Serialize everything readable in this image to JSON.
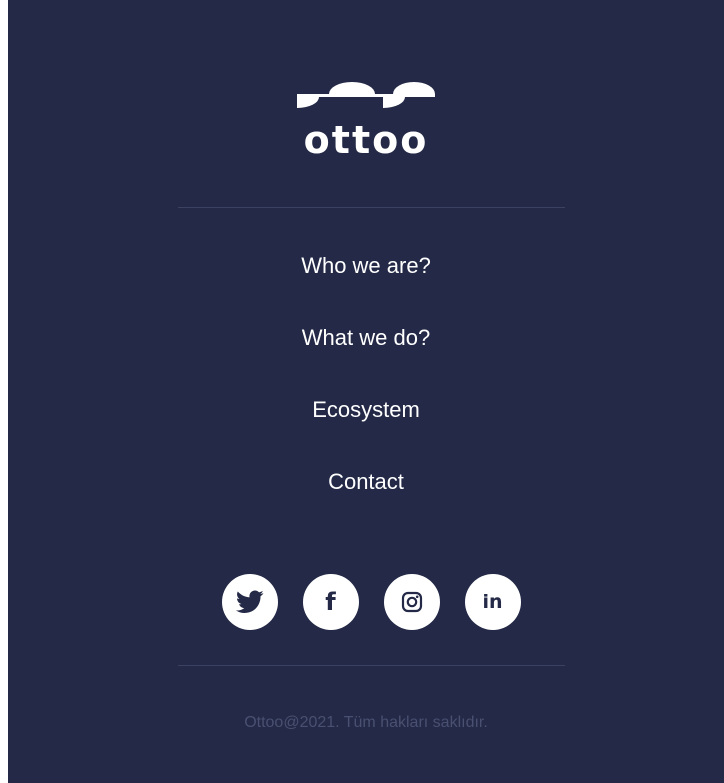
{
  "brand": {
    "name": "ottoo",
    "logo_icon": "wave-logo-icon"
  },
  "nav": {
    "items": [
      {
        "label": "Who we are?"
      },
      {
        "label": "What we do?"
      },
      {
        "label": "Ecosystem"
      },
      {
        "label": "Contact"
      }
    ]
  },
  "social": {
    "icons": [
      "twitter-icon",
      "facebook-icon",
      "instagram-icon",
      "linkedin-icon"
    ],
    "facebook_glyph": "f",
    "linkedin_glyph": "in"
  },
  "footer": {
    "copyright": "Ottoo@2021. Tüm hakları saklıdır."
  },
  "colors": {
    "background": "#232946",
    "text": "#ffffff",
    "divider": "#3b4160",
    "muted_text": "#495071",
    "page_margin": "#ffffff"
  }
}
